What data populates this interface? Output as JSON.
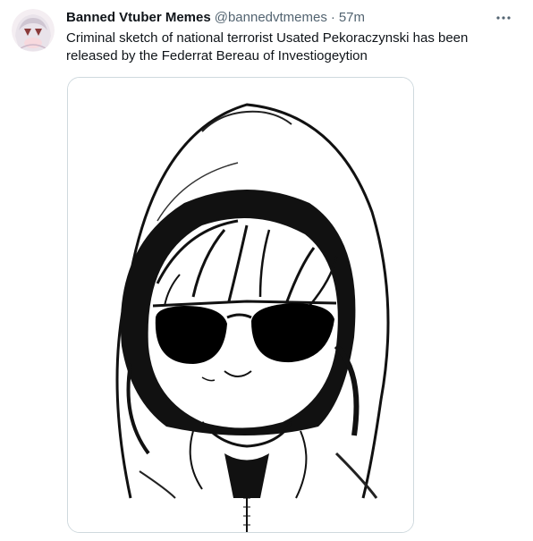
{
  "tweet": {
    "display_name": "Banned Vtuber Memes",
    "handle": "@bannedvtmemes",
    "separator": "·",
    "time": "57m",
    "text": "Criminal sketch of national terrorist Usated Pekoraczynski has been released by the Federrat Bereau of Investiogeytion"
  },
  "icons": {
    "avatar": "avatar-anime-girl-icon",
    "more": "more-dots-icon"
  },
  "colors": {
    "text_primary": "#0f1419",
    "text_secondary": "#536471",
    "border": "#cfd9de"
  }
}
